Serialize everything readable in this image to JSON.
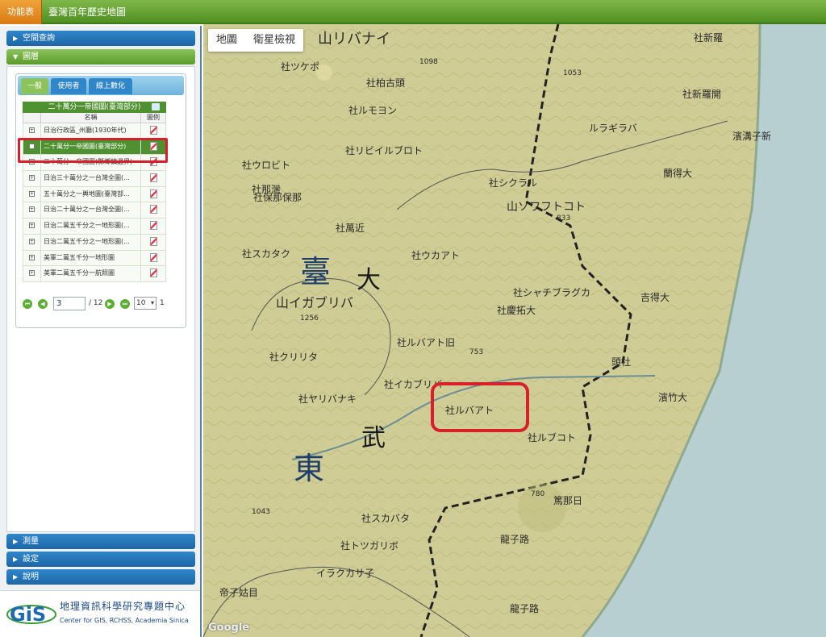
{
  "topbar": {
    "menu_label": "功能表",
    "title": "臺灣百年歷史地圖"
  },
  "sidebar": {
    "sections_top": [
      {
        "label": "空間查詢",
        "open": false
      },
      {
        "label": "圖層",
        "open": true
      }
    ],
    "tabs": [
      "一般",
      "使用者",
      "線上數化"
    ],
    "grid": {
      "title": "二十萬分一帝國圖(臺灣部分)",
      "col_name": "名稱",
      "col_legend": "圖例",
      "rows": [
        "日治行政區_州廳(1930年代)",
        "二十萬分一帝國圖(臺灣部分)",
        "二十萬分一帝國圖(縣鄉鎮邊界)",
        "日治三十萬分之一台灣全圖(...",
        "五十萬分之一輿地圖(臺灣部...",
        "日治二十萬分之一台灣全圖(...",
        "日治二萬五千分之一地形圖(...",
        "日治二萬五千分之一地形圖(...",
        "美軍二萬五千分一地形圖",
        "美軍二萬五千分一航照圖"
      ],
      "selected_index": 1
    },
    "pager": {
      "page": "3",
      "total": "/ 12",
      "page_size": "10",
      "extra": "1"
    },
    "sections_bottom": [
      "測量",
      "設定",
      "說明"
    ],
    "logo": {
      "mark": "GiS",
      "cn": "地理資訊科學研究專題中心",
      "en": "Center for GIS, RCHSS, Academia Sinica"
    }
  },
  "map": {
    "tabs": [
      "地圖",
      "衛星檢視"
    ],
    "active_tab": 0,
    "attribution": "Google",
    "labels": {
      "l1": "山リバナイ",
      "l2": "社ツケポ",
      "l3": "社柏古頭",
      "l4": "社ルモヨン",
      "l5": "社リビイルブロト",
      "l6": "社ウロビト",
      "l7": "社保那保那",
      "l8": "社萬近",
      "l9": "社スカタク",
      "l10": "社ウカアト",
      "l11": "山イガブリバ",
      "l12": "社クリリタ",
      "l13": "社ルバアト旧",
      "l14": "社イカブリバ",
      "l15": "社ヤリバナキ",
      "l16": "社ルバアト",
      "l17": "社ルブコト",
      "l18": "社スカバタ",
      "l19": "社トツガリボ",
      "l20": "イラクカサ子",
      "l21": "ルラギラバ",
      "l22": "社シクラル",
      "l23": "山ソワフトコト",
      "l24": "社シャチブラグカ",
      "l25": "社慶拓大",
      "l26": "社那灣",
      "l27": "蘭得大",
      "l28": "吉得大",
      "l29": "頭社",
      "l30": "篤那日",
      "l31": "龍子路",
      "l32": "帝子姑目",
      "l33": "龍子路",
      "l34": "濱溝子新",
      "l35": "濱竹大",
      "l36": "社新羅開",
      "l37": "社新羅",
      "big1": "臺",
      "big2": "東",
      "mid1": "大",
      "mid2": "武",
      "e1": "1098",
      "e2": "1053",
      "e3": "1043",
      "e4": "753",
      "e5": "780",
      "e6": "1256",
      "e7": "833"
    },
    "colors": {
      "land": "#c9c88d",
      "sea": "#b8cfd2",
      "route": "#222222",
      "highlight": "#d8202a"
    }
  }
}
